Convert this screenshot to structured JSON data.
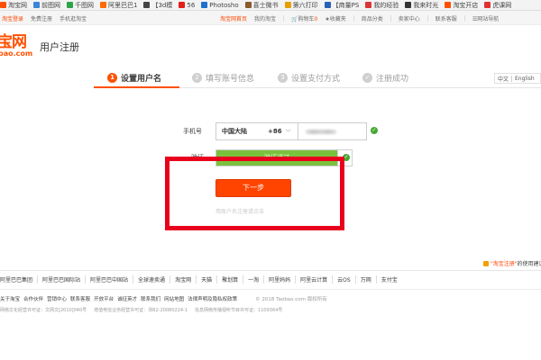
{
  "bookmarks": [
    {
      "label": "淘宝网",
      "color": "#ff5000"
    },
    {
      "label": "前图网",
      "color": "#3a86d9"
    },
    {
      "label": "千图网",
      "color": "#2fa34a"
    },
    {
      "label": "阿里巴巴1",
      "color": "#ff6a00"
    },
    {
      "label": "【3d模",
      "color": "#444444"
    },
    {
      "label": "56",
      "color": "#e61f19"
    },
    {
      "label": "Photosho",
      "color": "#1f6fcf"
    },
    {
      "label": "喜士微书",
      "color": "#8a5a2b"
    },
    {
      "label": "第六打印",
      "color": "#e5a000"
    },
    {
      "label": "【商量PS",
      "color": "#2a61b8"
    },
    {
      "label": "我的经验",
      "color": "#d33"
    },
    {
      "label": "我来时光",
      "color": "#333333"
    },
    {
      "label": "淘宝开店",
      "color": "#ff5000"
    },
    {
      "label": "虎课网",
      "color": "#e03131"
    }
  ],
  "site_nav": {
    "left": [
      "淘宝登录",
      "免费注册",
      "手机逛淘宝"
    ],
    "home": "淘宝网首页",
    "my_taobao": "我的淘宝",
    "cart_label": "购物车",
    "cart_count": "0",
    "favorites": "收藏夹",
    "categories": "商品分类",
    "seller": "卖家中心",
    "service": "联系客服",
    "site_map": "网站导航"
  },
  "header": {
    "logo_text": "宝网",
    "logo_domain": "bao.com",
    "title": "用户注册"
  },
  "steps": [
    {
      "num": "1",
      "label": "设置用户名",
      "state": "active"
    },
    {
      "num": "2",
      "label": "填写账号信息",
      "state": "pending"
    },
    {
      "num": "3",
      "label": "设置支付方式",
      "state": "pending"
    },
    {
      "num": "✓",
      "label": "注册成功",
      "state": "pending"
    }
  ],
  "lang": {
    "zh": "中文",
    "en": "English"
  },
  "form": {
    "phone_label": "手机号",
    "country": "中国大陆",
    "country_code": "+86",
    "verify_label": "验证",
    "verify_text": "验证通过",
    "next_button": "下一步",
    "faint_link": "用账户名注册请点击"
  },
  "footer": {
    "tip_prefix": "\"淘宝注册\"",
    "tip_suffix": "的使用建议",
    "links": [
      "阿里巴巴集团",
      "阿里巴巴国际站",
      "阿里巴巴中国站",
      "全球速卖通",
      "淘宝网",
      "天猫",
      "聚划算",
      "一淘",
      "阿里妈妈",
      "阿里云计算",
      "云OS",
      "万网",
      "支付宝"
    ],
    "about": [
      "关于淘宝",
      "合作伙伴",
      "营销中心",
      "联系客服",
      "开放平台",
      "诚征英才",
      "联系我们",
      "网站地图",
      "法律声明及隐私权政策"
    ],
    "copyright": "© 2018 Taobao.com 版权所有",
    "licenses": [
      "网络文化经营许可证：文网文[2010]040号",
      "增值电信业务经营许可证：浙B2-20080224-1",
      "信息网络传播视听节目许可证：1109364号"
    ]
  },
  "annotation": {
    "color": "#e8001c"
  }
}
